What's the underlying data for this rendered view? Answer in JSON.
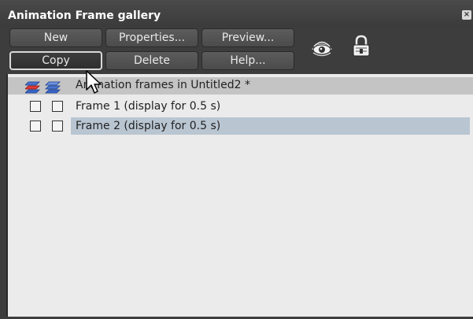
{
  "window": {
    "title": "Animation Frame gallery",
    "close_glyph": "×"
  },
  "toolbar": {
    "buttons": [
      {
        "label": "New"
      },
      {
        "label": "Properties..."
      },
      {
        "label": "Preview..."
      },
      {
        "label": "Copy"
      },
      {
        "label": "Delete"
      },
      {
        "label": "Help..."
      }
    ],
    "icons": [
      "eye-visibility-icon",
      "lock-icon"
    ]
  },
  "list": {
    "header": {
      "icons": [
        "layers-red-icon",
        "layers-blue-icon"
      ],
      "text": "Animation frames in Untitled2 *"
    },
    "rows": [
      {
        "label": "Frame 1 (display for 0.5 s)",
        "selected": false,
        "checkbox1": false,
        "checkbox2": false
      },
      {
        "label": "Frame 2 (display for 0.5 s)",
        "selected": true,
        "checkbox1": false,
        "checkbox2": false
      }
    ]
  },
  "colors": {
    "panel_bg": "#3d3d3d",
    "list_bg": "#ebebeb",
    "header_bg": "#c4c4c4",
    "selection_bg": "#b9c6d2"
  }
}
